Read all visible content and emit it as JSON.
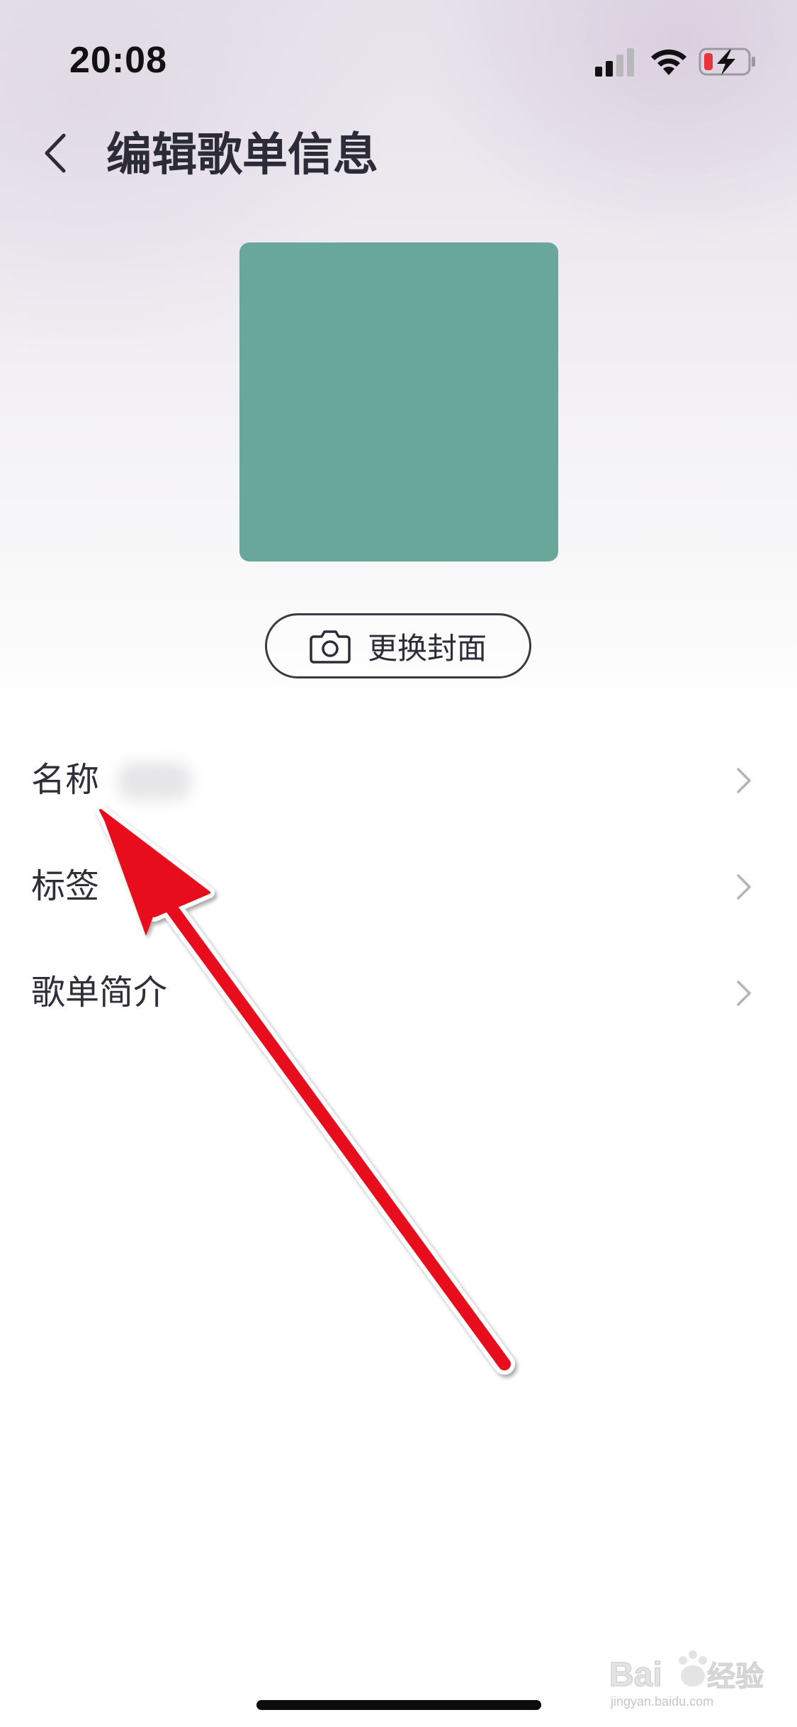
{
  "status_bar": {
    "time": "20:08",
    "signal_icon": "cellular-signal-icon",
    "wifi_icon": "wifi-icon",
    "battery_icon": "battery-charging-low-icon"
  },
  "header": {
    "back_icon": "chevron-left-icon",
    "title": "编辑歌单信息"
  },
  "cover": {
    "color": "#69a79b",
    "change_button_label": "更换封面",
    "change_button_icon": "camera-icon"
  },
  "fields": {
    "name_label": "名称",
    "tags_label": "标签",
    "intro_label": "歌单简介",
    "chevron_icon": "chevron-right-icon"
  },
  "annotation": {
    "color": "#e8101a",
    "icon": "red-arrow-pointer"
  },
  "watermark": {
    "text": "jingyan.baidu.com",
    "logo": "Baidu经验"
  }
}
